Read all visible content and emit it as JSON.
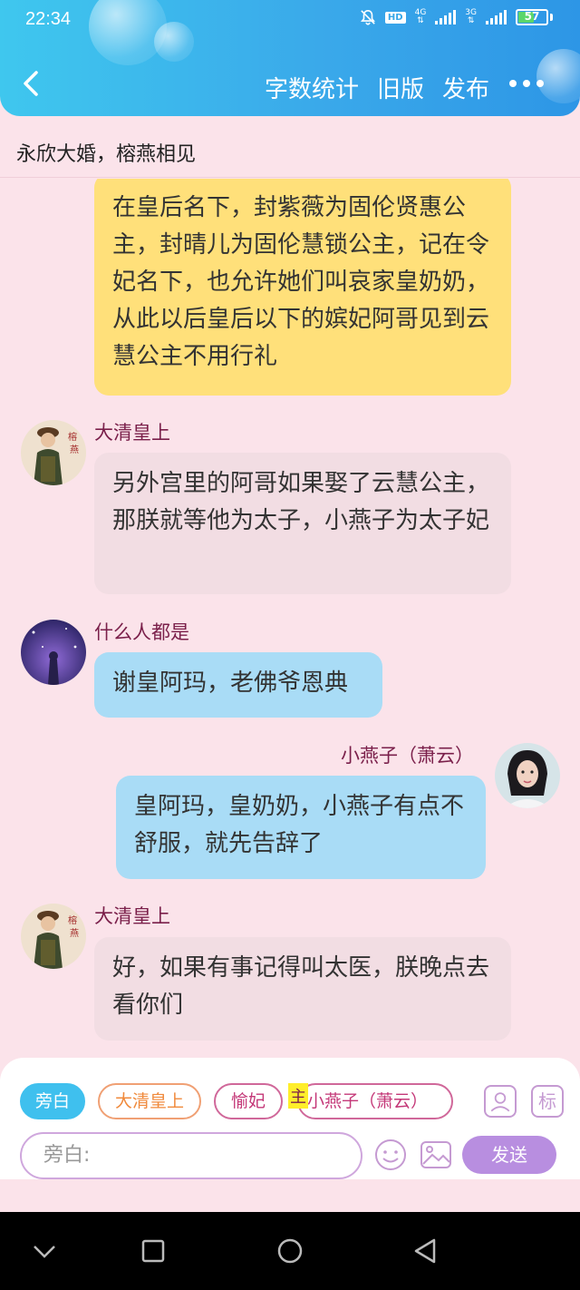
{
  "status": {
    "time": "22:34",
    "hd": "HD",
    "net1": "4G",
    "net2": "3G",
    "battery": "57",
    "battery_level": 0.57
  },
  "nav": {
    "count_label": "字数统计",
    "old_label": "旧版",
    "publish_label": "发布"
  },
  "title": "永欣大婚，榕燕相见",
  "messages": [
    {
      "sender": "",
      "text": "在皇后名下，封紫薇为固伦贤惠公主，封晴儿为固伦慧锁公主，记在令妃名下，也允许她们叫哀家皇奶奶，从此以后皇后以下的嫔妃阿哥见到云慧公主不用行礼"
    },
    {
      "sender": "大清皇上",
      "text": "另外宫里的阿哥如果娶了云慧公主，那朕就等他为太子，小燕子为太子妃"
    },
    {
      "sender": "什么人都是",
      "text": "谢皇阿玛，老佛爷恩典"
    },
    {
      "sender": "小燕子（萧云）",
      "text": "皇阿玛，皇奶奶，小燕子有点不舒服，就先告辞了"
    },
    {
      "sender": "大清皇上",
      "text": "好，如果有事记得叫太医，朕晚点去看你们"
    }
  ],
  "composer": {
    "roles": [
      "旁白",
      "大清皇上",
      "愉妃",
      "小燕子（萧云）"
    ],
    "main_tag": "主",
    "mark_label": "标",
    "input_placeholder": "旁白:",
    "send_label": "发送"
  },
  "colors": {
    "header": "#3aa9ea",
    "background": "#fbe3ea",
    "accent_purple": "#b88ee0"
  }
}
